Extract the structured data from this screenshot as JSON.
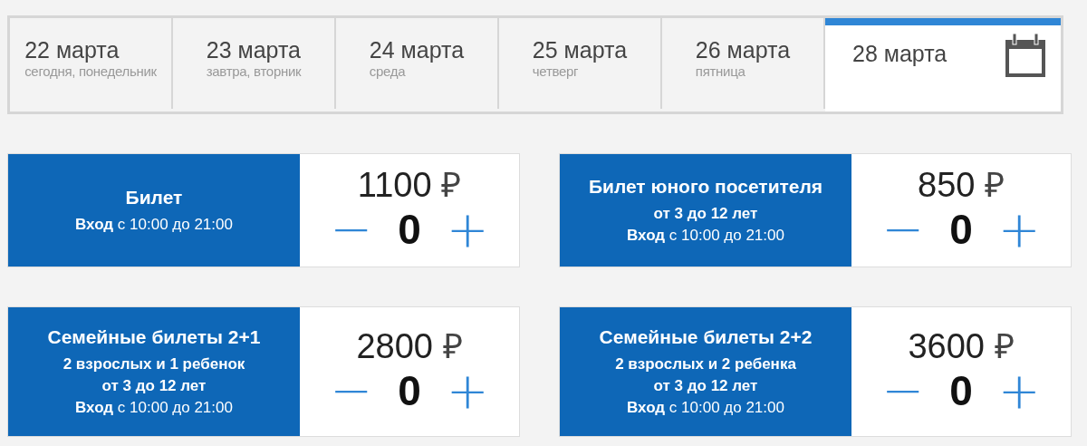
{
  "date_tabs": [
    {
      "date": "22 марта",
      "weekday": "сегодня, понедельник",
      "selected": false
    },
    {
      "date": "23 марта",
      "weekday": "завтра, вторник",
      "selected": false
    },
    {
      "date": "24 марта",
      "weekday": "среда",
      "selected": false
    },
    {
      "date": "25 марта",
      "weekday": "четверг",
      "selected": false
    },
    {
      "date": "26 марта",
      "weekday": "пятница",
      "selected": false
    },
    {
      "date": "28 марта",
      "selected": true,
      "kind": "calendar"
    }
  ],
  "tickets": [
    {
      "title": "Билет",
      "lines": [
        "**Вход** с 10:00 до 21:00"
      ],
      "price": "1100",
      "currency": "₽",
      "minus": "−",
      "quantity": "0",
      "plus": "+"
    },
    {
      "title": "Билет юного посетителя",
      "lines": [
        "от 3 до 12 лет",
        "**Вход** с 10:00 до 21:00"
      ],
      "price": "850",
      "currency": "₽",
      "minus": "−",
      "quantity": "0",
      "plus": "+"
    },
    {
      "title": "Семейные билеты 2+1",
      "lines": [
        "2 взрослых и 1 ребенок",
        "от 3 до 12 лет",
        "**Вход** с 10:00 до 21:00"
      ],
      "price": "2800",
      "currency": "₽",
      "minus": "−",
      "quantity": "0",
      "plus": "+"
    },
    {
      "title": "Семейные билеты 2+2",
      "lines": [
        "2 взрослых и 2 ребенка",
        "от 3 до 12 лет",
        "**Вход** с 10:00 до 21:00"
      ],
      "price": "3600",
      "currency": "₽",
      "minus": "−",
      "quantity": "0",
      "plus": "+"
    }
  ]
}
